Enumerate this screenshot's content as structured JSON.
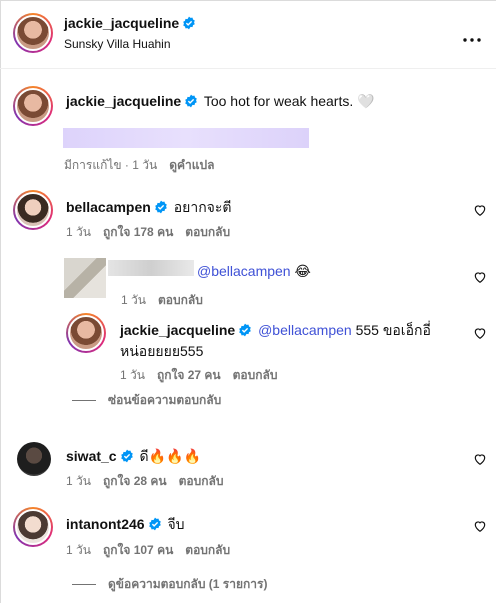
{
  "post_header": {
    "username": "jackie_jacqueline",
    "location": "Sunsky Villa Huahin"
  },
  "caption": {
    "username": "jackie_jacqueline",
    "text": "Too hot for weak hearts. 🤍",
    "edited": "มีการแก้ไข · 1 วัน",
    "translate": "ดูคำแปล"
  },
  "comments": [
    {
      "username": "bellacampen",
      "text": "อยากจะตี",
      "time": "1 วัน",
      "likes": "ถูกใจ 178 คน",
      "reply": "ตอบกลับ"
    },
    {
      "username": "siwat_c",
      "text": "ดี🔥🔥🔥",
      "time": "1 วัน",
      "likes": "ถูกใจ 28 คน",
      "reply": "ตอบกลับ"
    },
    {
      "username": "intanont246",
      "text": "จีบ",
      "time": "1 วัน",
      "likes": "ถูกใจ 107 คน",
      "reply": "ตอบกลับ",
      "view_replies": "ดูข้อความตอบกลับ (1 รายการ)"
    }
  ],
  "replies": [
    {
      "mention": "@bellacampen",
      "text": " 😂",
      "time": "1 วัน",
      "reply": "ตอบกลับ"
    },
    {
      "username": "jackie_jacqueline",
      "mention": "@bellacampen",
      "text_line1": " 555 ขอเอ็กอี่",
      "text_line2": "หน่อยยยย555",
      "time": "1 วัน",
      "likes": "ถูกใจ 27 คน",
      "reply": "ตอบกลับ"
    }
  ],
  "hide_replies": "ซ่อนข้อความตอบกลับ",
  "icons": {
    "more": "more-icon",
    "verified": "verified-badge-icon",
    "heart": "heart-outline-icon"
  },
  "colors": {
    "verified": "#0095f6",
    "mention": "#3f51d6",
    "meta": "#737373"
  }
}
